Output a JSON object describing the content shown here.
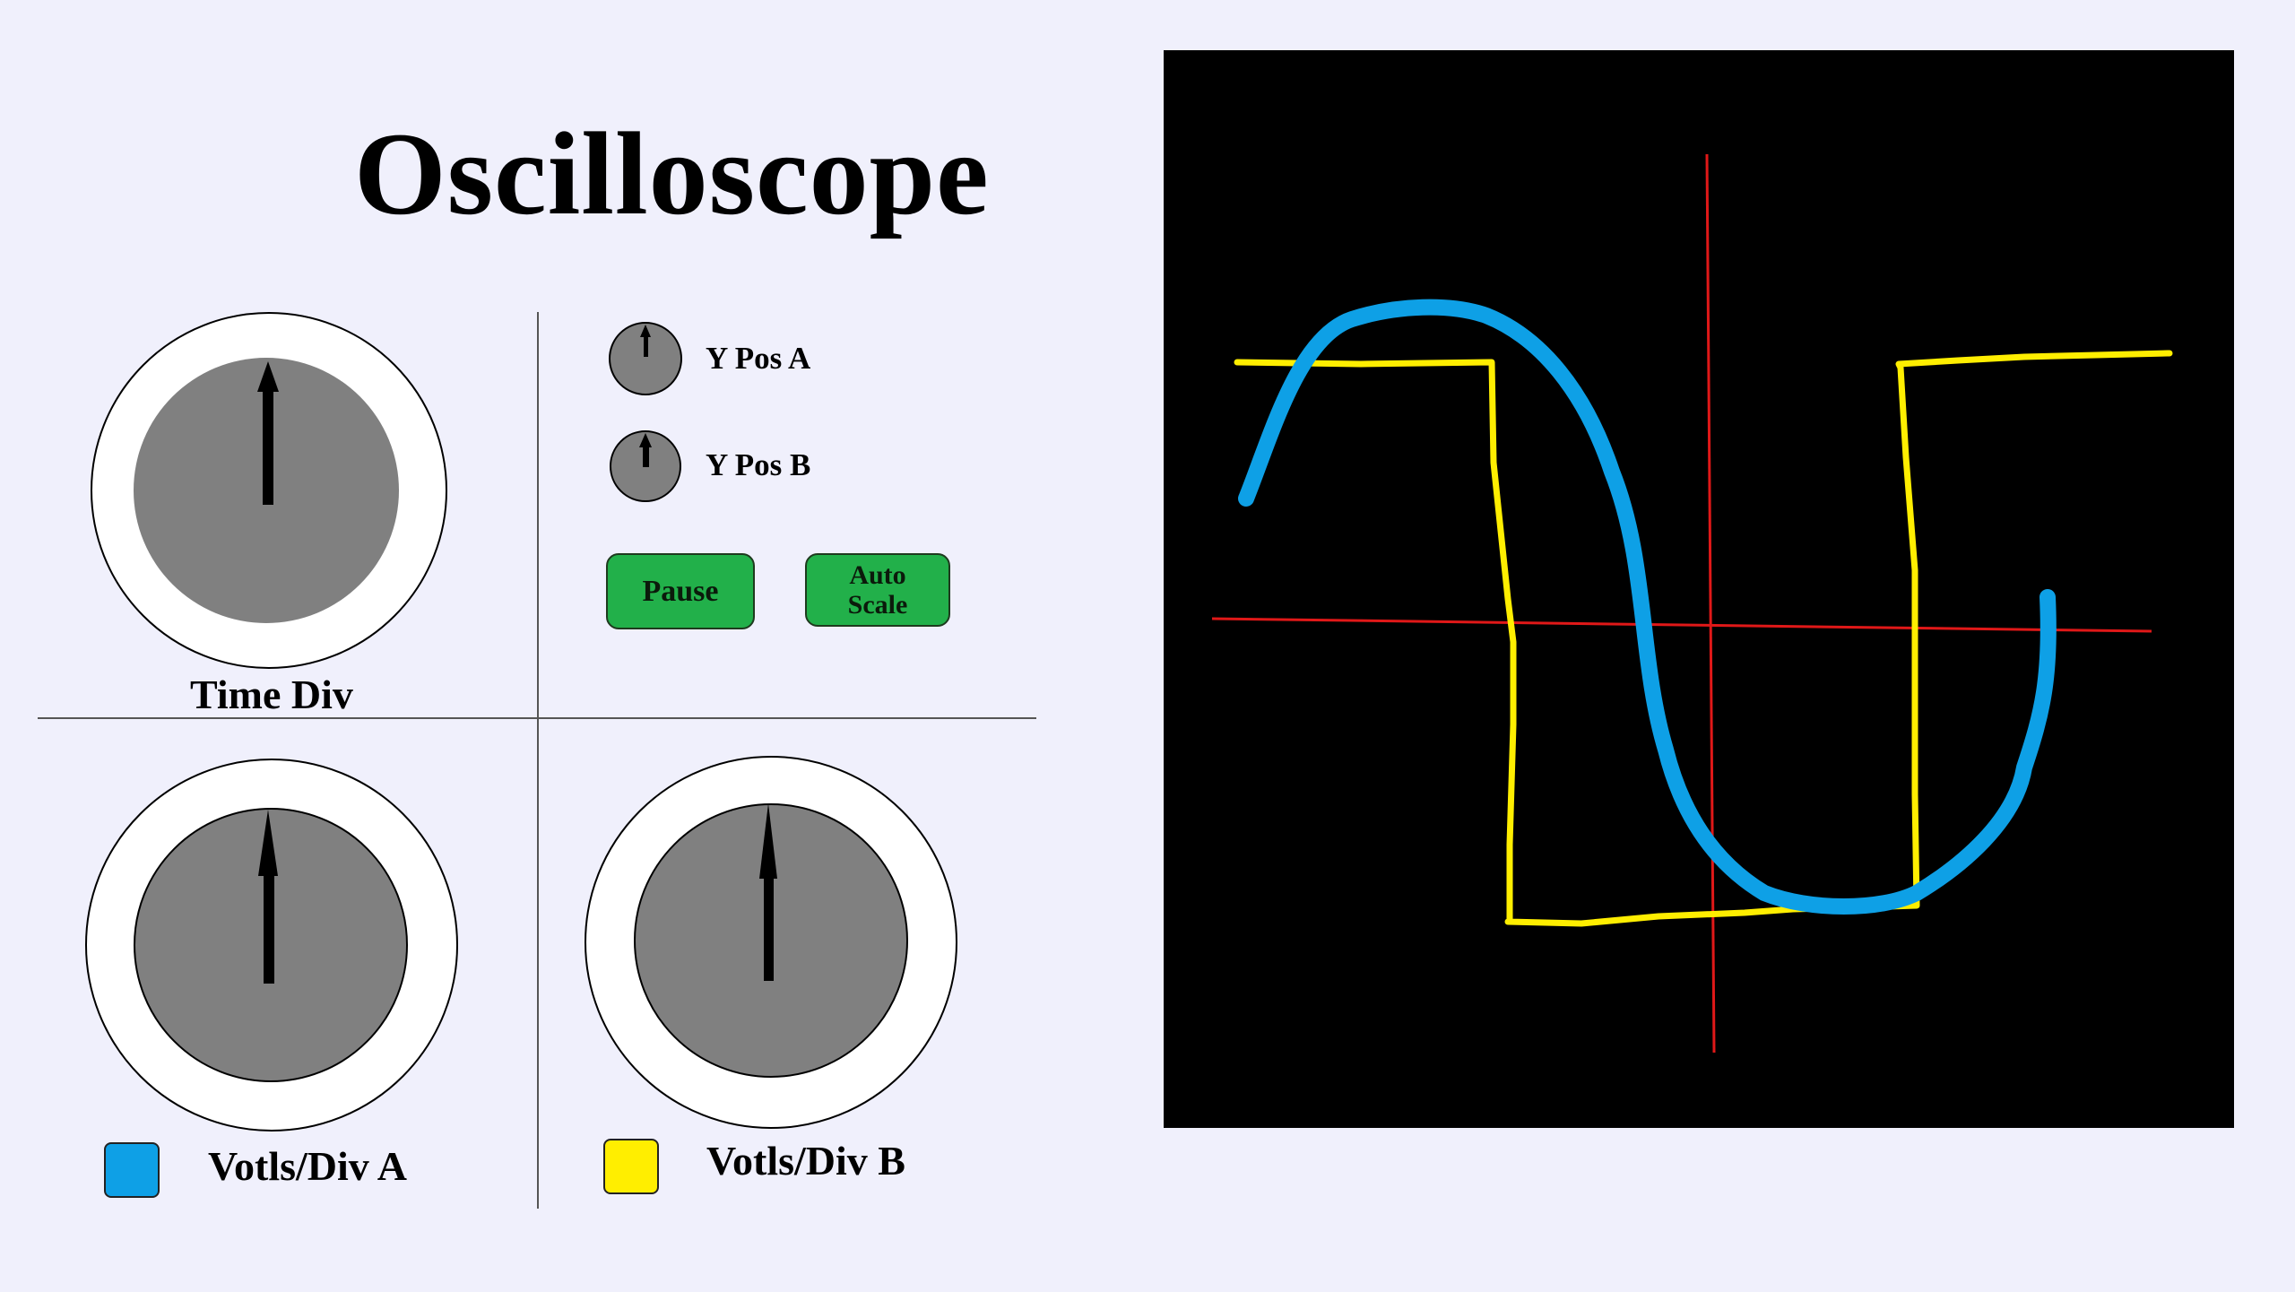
{
  "title": "Oscilloscope",
  "knobs": {
    "time_div": {
      "label": "Time Div"
    },
    "volts_div_a": {
      "label": "Votls/Div A",
      "channel_color": "#0ea0e6"
    },
    "volts_div_b": {
      "label": "Votls/Div B",
      "channel_color": "#ffee00"
    },
    "y_pos_a": {
      "label": "Y Pos A"
    },
    "y_pos_b": {
      "label": "Y Pos B"
    }
  },
  "buttons": {
    "pause": "Pause",
    "auto_scale_line1": "Auto",
    "auto_scale_line2": "Scale"
  },
  "display": {
    "background": "#000000",
    "axis_color": "#e01818",
    "trace_a_color": "#0ea0e6",
    "trace_b_color": "#ffee00"
  }
}
